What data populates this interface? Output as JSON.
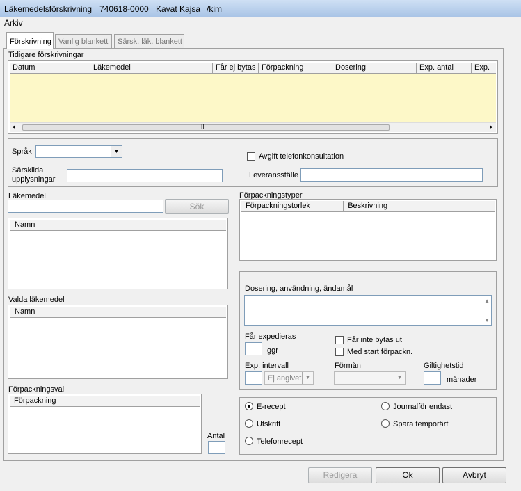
{
  "window": {
    "title": "Läkemedelsförskrivning",
    "patient_id": "740618-0000",
    "patient_name": "Kavat Kajsa",
    "user": "/kim"
  },
  "menu": {
    "arkiv": "Arkiv"
  },
  "tabs": [
    "Förskrivning",
    "Vanlig blankett",
    "Särsk. läk. blankett"
  ],
  "prior": {
    "label": "Tidigare förskrivningar",
    "columns": [
      "Datum",
      "Läkemedel",
      "Får ej bytas",
      "Förpackning",
      "Dosering",
      "Exp. antal",
      "Exp."
    ],
    "scroll_mark": "III"
  },
  "form": {
    "sprak_label": "Språk",
    "sarskilda_label_1": "Särskilda",
    "sarskilda_label_2": "upplysningar",
    "avgift_label": "Avgift telefonkonsultation",
    "leverans_label": "Leveransställe"
  },
  "lakemedel": {
    "label": "Läkemedel",
    "sok_button": "Sök",
    "list_header": "Namn"
  },
  "valda": {
    "label": "Valda läkemedel",
    "list_header": "Namn"
  },
  "forpackningsval": {
    "label": "Förpackningsval",
    "list_header": "Förpackning",
    "antal_label": "Antal"
  },
  "forpackningstyper": {
    "label": "Förpackningstyper",
    "columns": [
      "Förpackningstorlek",
      "Beskrivning"
    ]
  },
  "dosering": {
    "label": "Dosering, användning, ändamål",
    "far_expedieras": "Får expedieras",
    "ggr": "ggr",
    "far_inte_bytas": "Får inte bytas ut",
    "med_start": "Med start förpackn.",
    "exp_intervall": "Exp. intervall",
    "ej_angivet": "Ej angivet",
    "forman": "Förmån",
    "giltighetstid": "Giltighetstid",
    "manader": "månader"
  },
  "delivery": {
    "e_recept": "E-recept",
    "utskrift": "Utskrift",
    "telefonrecept": "Telefonrecept",
    "journalfor": "Journalför endast",
    "spara": "Spara temporärt",
    "selected": "E-recept"
  },
  "buttons": {
    "redigera": "Redigera",
    "ok": "Ok",
    "avbryt": "Avbryt"
  },
  "colors": {
    "grid_bg": "#fdf8c8",
    "title_bg": "#b8cfeb"
  }
}
